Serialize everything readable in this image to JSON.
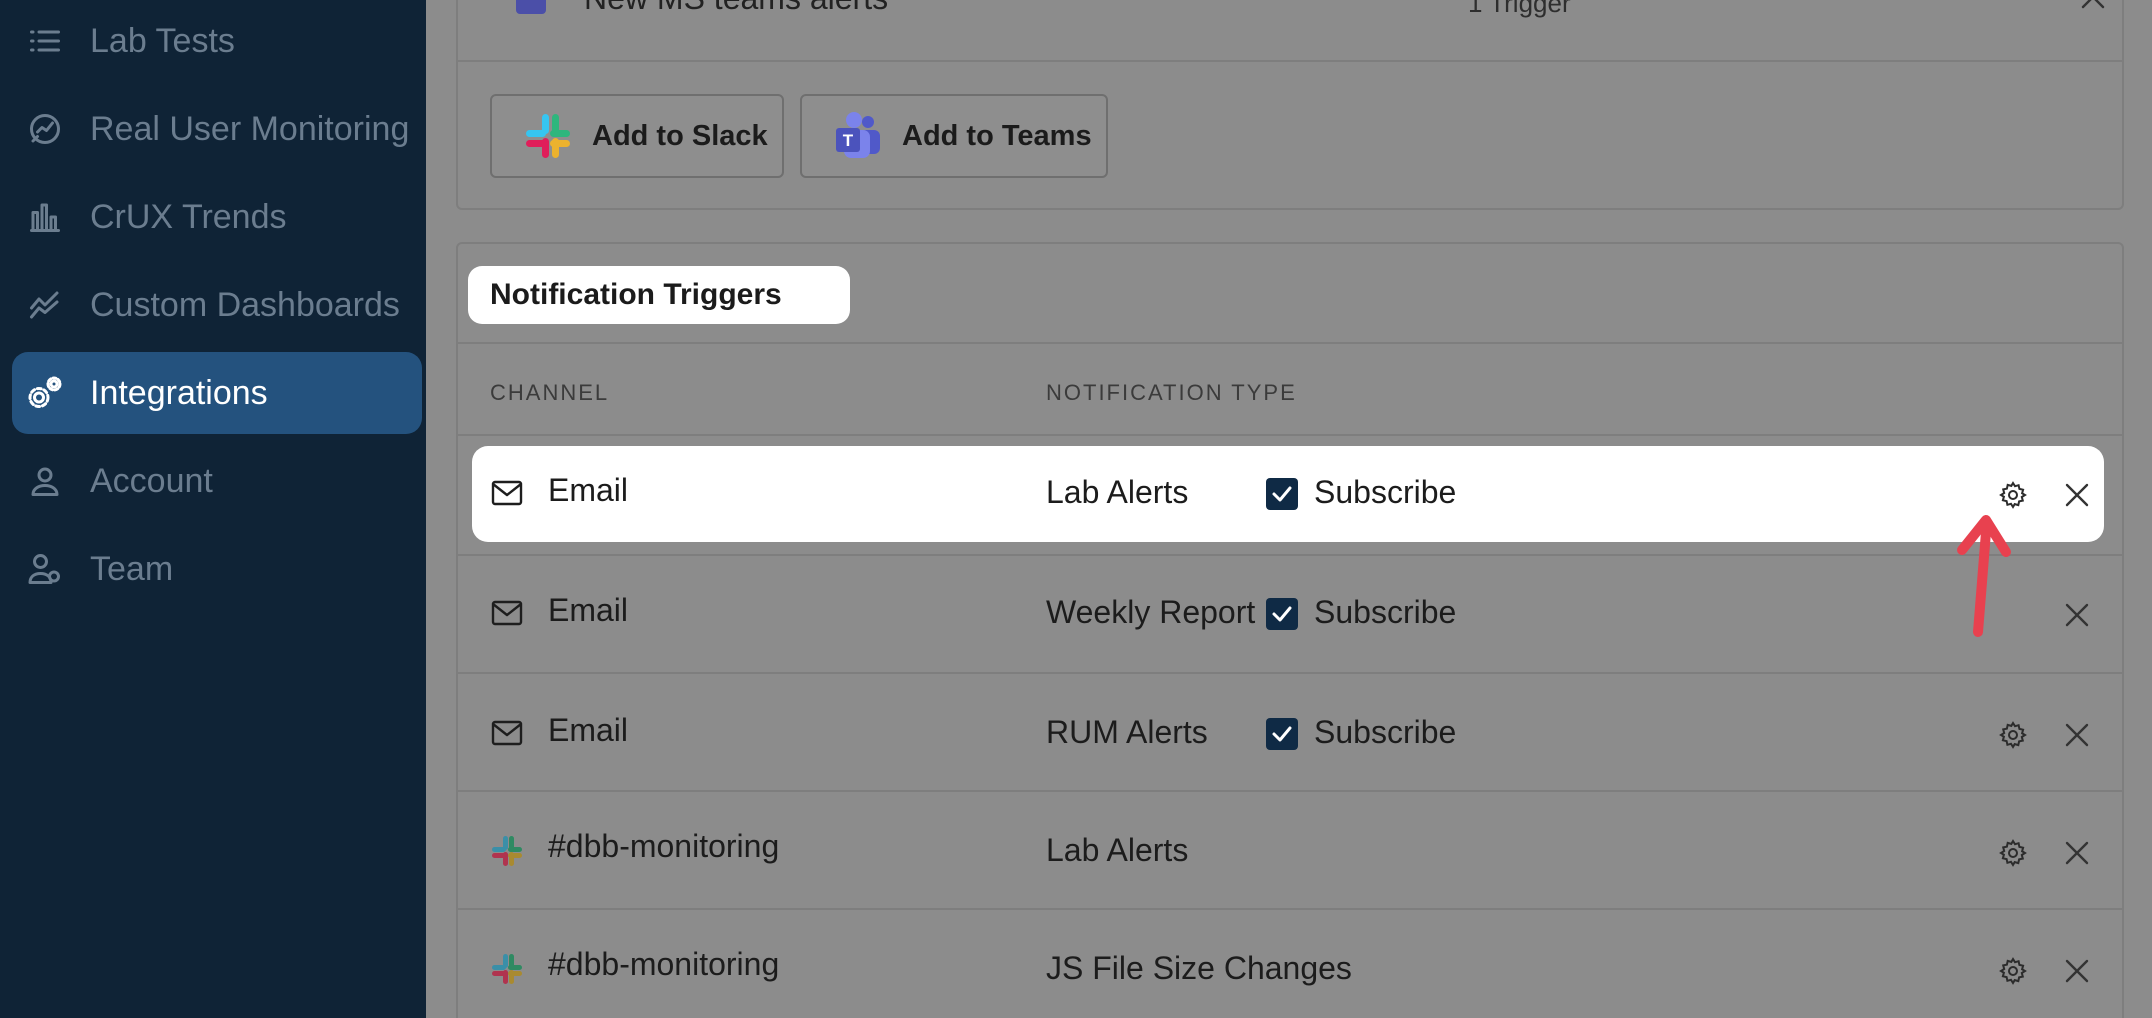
{
  "sidebar": {
    "items": [
      {
        "label": "Lab Tests",
        "icon": "list-icon"
      },
      {
        "label": "Real User Monitoring",
        "icon": "gauge-icon"
      },
      {
        "label": "CrUX Trends",
        "icon": "bar-chart-icon"
      },
      {
        "label": "Custom Dashboards",
        "icon": "line-chart-icon"
      },
      {
        "label": "Integrations",
        "icon": "gears-icon",
        "active": true
      },
      {
        "label": "Account",
        "icon": "user-icon"
      },
      {
        "label": "Team",
        "icon": "team-icon"
      }
    ]
  },
  "integrations": {
    "top_row": {
      "title": "New MS teams alerts",
      "trigger_count": "1 Trigger"
    },
    "add_slack_label": "Add to Slack",
    "add_teams_label": "Add to Teams"
  },
  "triggers": {
    "title": "Notification Triggers",
    "col_channel": "CHANNEL",
    "col_type": "NOTIFICATION TYPE",
    "rows": [
      {
        "channel": "Email",
        "channel_icon": "mail-icon",
        "type": "Lab Alerts",
        "subscribe": "Subscribe",
        "subscribed": true,
        "has_settings": true
      },
      {
        "channel": "Email",
        "channel_icon": "mail-icon",
        "type": "Weekly Report",
        "subscribe": "Subscribe",
        "subscribed": true,
        "has_settings": false
      },
      {
        "channel": "Email",
        "channel_icon": "mail-icon",
        "type": "RUM Alerts",
        "subscribe": "Subscribe",
        "subscribed": true,
        "has_settings": true
      },
      {
        "channel": "#dbb-monitoring",
        "channel_icon": "slack-icon",
        "type": "Lab Alerts",
        "has_settings": true
      },
      {
        "channel": "#dbb-monitoring",
        "channel_icon": "slack-icon",
        "type": "JS File Size Changes",
        "has_settings": true
      }
    ]
  },
  "colors": {
    "sidebar_bg": "#0f2336",
    "active_item": "#24527e",
    "checkbox": "#0f2a45",
    "arrow": "#e8414f"
  }
}
